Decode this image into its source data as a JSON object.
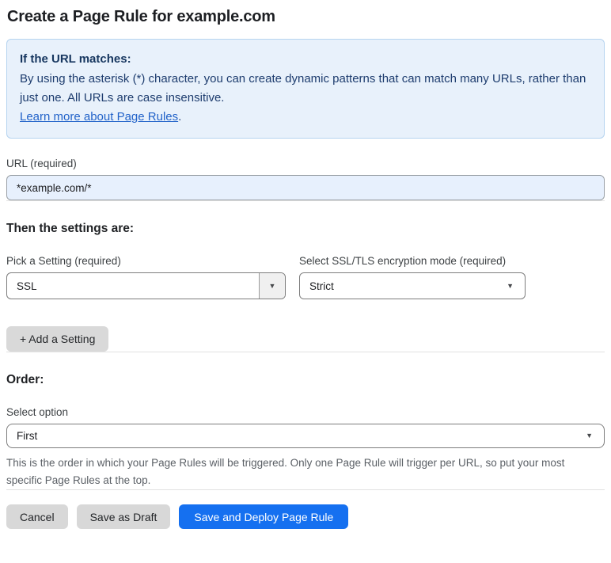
{
  "page": {
    "title": "Create a Page Rule for example.com"
  },
  "info_box": {
    "heading": "If the URL matches:",
    "body": "By using the asterisk (*) character, you can create dynamic patterns that can match many URLs, rather than just one. All URLs are case insensitive.",
    "link_label": "Learn more about Page Rules",
    "link_suffix": "."
  },
  "url_field": {
    "label": "URL (required)",
    "value": "*example.com/*"
  },
  "settings_section": {
    "heading": "Then the settings are:",
    "setting_picker": {
      "label": "Pick a Setting (required)",
      "value": "SSL"
    },
    "ssl_mode_picker": {
      "label": "Select SSL/TLS encryption mode (required)",
      "value": "Strict"
    },
    "add_setting_label": "+ Add a Setting"
  },
  "order_section": {
    "heading": "Order:",
    "select_label": "Select option",
    "value": "First",
    "helper_text": "This is the order in which your Page Rules will be triggered. Only one Page Rule will trigger per URL, so put your most specific Page Rules at the top."
  },
  "footer": {
    "cancel_label": "Cancel",
    "save_draft_label": "Save as Draft",
    "save_deploy_label": "Save and Deploy Page Rule"
  },
  "icons": {
    "dropdown_arrow": "▼"
  },
  "colors": {
    "accent_blue": "#1570f0",
    "info_bg": "#e8f1fb",
    "info_border": "#b5d3ef",
    "info_text": "#1d3c6e",
    "link_blue": "#2162c9",
    "url_input_bg": "#e7f0fd",
    "button_gray": "#d8d8d8"
  }
}
